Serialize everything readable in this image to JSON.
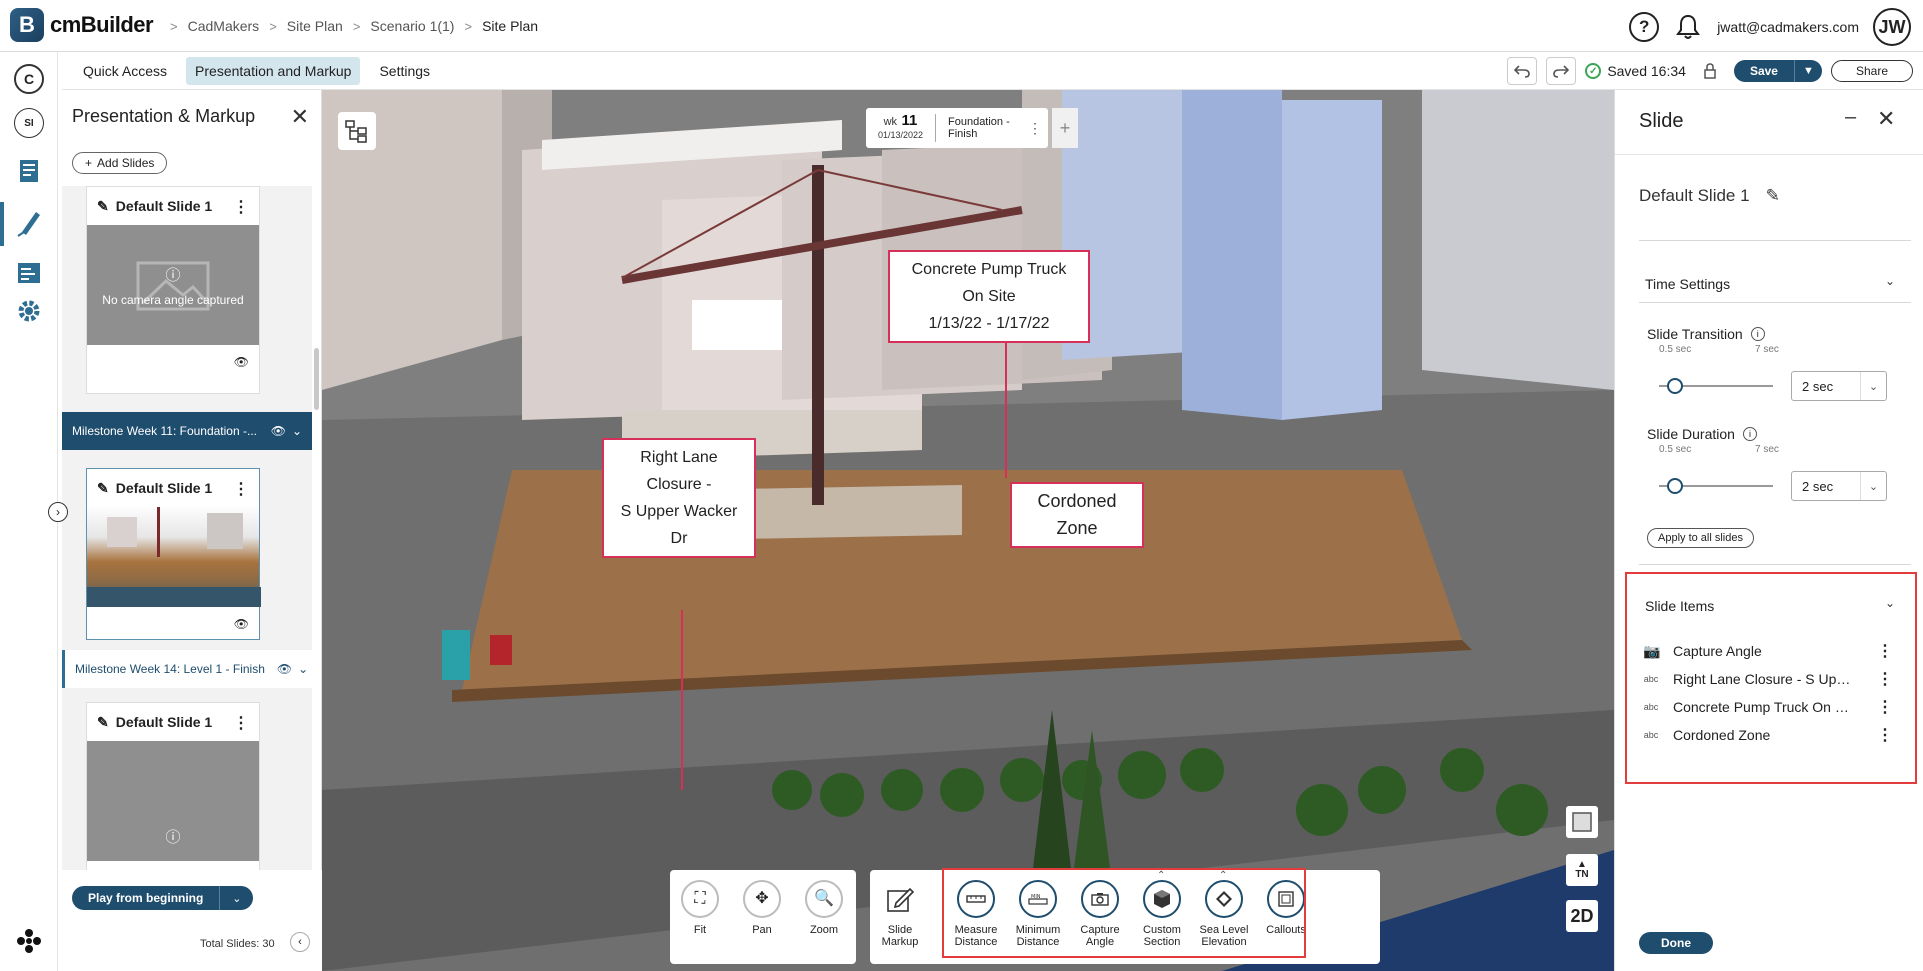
{
  "app": {
    "logo_letter": "B",
    "logo_text": "cmBuilder",
    "breadcrumb": [
      "CadMakers",
      "Site Plan",
      "Scenario 1(1)",
      "Site Plan"
    ],
    "user_email": "jwatt@cadmakers.com",
    "user_initials": "JW"
  },
  "tabs": [
    "Quick Access",
    "Presentation and Markup",
    "Settings"
  ],
  "toolbar": {
    "saved_text": "Saved 16:34",
    "save_label": "Save",
    "share_label": "Share"
  },
  "rail": {
    "c_label": "C",
    "si_label": "SI"
  },
  "left_panel": {
    "title": "Presentation & Markup",
    "add_slides": "Add Slides",
    "slides": [
      {
        "name": "Default Slide 1",
        "thumb_text": "No camera angle captured"
      },
      {
        "name": "Default Slide 1",
        "thumb_text": ""
      },
      {
        "name": "Default Slide 1",
        "thumb_text": ""
      }
    ],
    "milestones": [
      "Milestone Week 11: Foundation -...",
      "Milestone Week 14: Level 1 - Finish"
    ],
    "play_label": "Play from beginning",
    "total_slides": "Total Slides: 30"
  },
  "viewport": {
    "timeline": {
      "wk": "wk",
      "week_num": "11",
      "date": "01/13/2022",
      "label": "Foundation - Finish"
    },
    "callouts": {
      "pump": [
        "Concrete Pump Truck On Site",
        "1/13/22 - 1/17/22"
      ],
      "lane": [
        "Right Lane Closure -",
        "S Upper Wacker Dr"
      ],
      "zone": [
        "Cordoned Zone"
      ]
    },
    "nav_tools": [
      "Fit",
      "Pan",
      "Zoom"
    ],
    "markup_tools": [
      {
        "label1": "Slide",
        "label2": "Markup"
      },
      {
        "label1": "Measure",
        "label2": "Distance"
      },
      {
        "label1": "Minimum",
        "label2": "Distance"
      },
      {
        "label1": "Capture",
        "label2": "Angle"
      },
      {
        "label1": "Custom",
        "label2": "Section"
      },
      {
        "label1": "Sea Level",
        "label2": "Elevation"
      },
      {
        "label1": "Callouts",
        "label2": ""
      }
    ],
    "compass_label": "TN",
    "view_2d": "2D"
  },
  "right_panel": {
    "title": "Slide",
    "slide_name": "Default Slide 1",
    "time_settings": "Time Settings",
    "transition": {
      "label": "Slide Transition",
      "min": "0.5 sec",
      "max": "7 sec",
      "value": "2 sec"
    },
    "duration": {
      "label": "Slide Duration",
      "min": "0.5 sec",
      "max": "7 sec",
      "value": "2 sec"
    },
    "apply_all": "Apply to all slides",
    "slide_items_title": "Slide Items",
    "slide_items": [
      {
        "icon": "camera-icon",
        "label": "Capture Angle"
      },
      {
        "icon": "text-icon",
        "label": "Right Lane Closure - S Upper Wacker Dr"
      },
      {
        "icon": "text-icon",
        "label": "Concrete Pump Truck On Site"
      },
      {
        "icon": "text-icon",
        "label": "Cordoned Zone"
      }
    ],
    "done_label": "Done"
  },
  "colors": {
    "primary": "#1f4d6e",
    "accent_tab": "#d3e6ee",
    "callout_border": "#d62f5a",
    "highlight_box": "#e23c3c",
    "saved_check": "#3aa655"
  }
}
